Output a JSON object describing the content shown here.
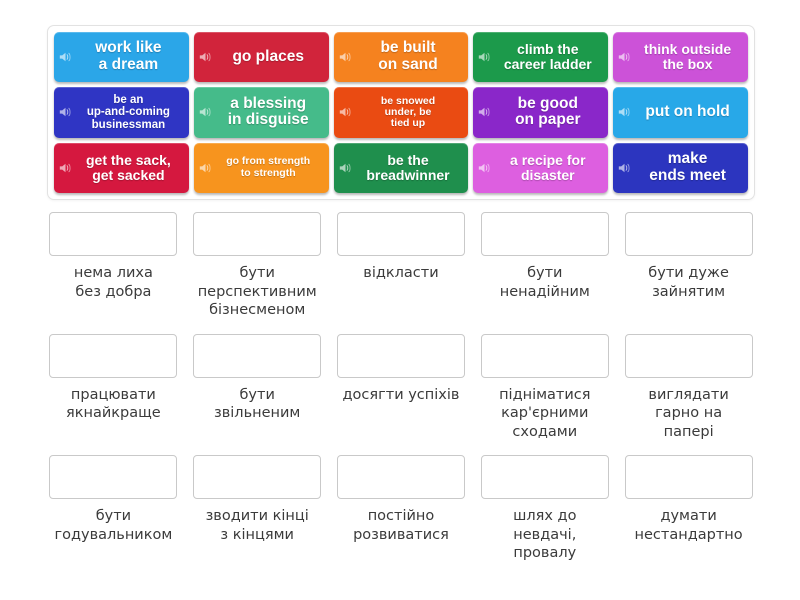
{
  "activity": {
    "type": "match-up-drag-drop",
    "icon": "speaker-icon",
    "colors": {
      "tile_row1": [
        "#2ba6e8",
        "#d1243b",
        "#f5821f",
        "#1c9a4b",
        "#cc52d8"
      ],
      "tile_row2": [
        "#2f35c4",
        "#45bb8a",
        "#ea4b12",
        "#8a27c9",
        "#28a8e8"
      ],
      "tile_row3": [
        "#d5183f",
        "#f7941e",
        "#1f8f4d",
        "#dd5fe0",
        "#2c35bf"
      ],
      "panel_border": "#e2e2e2",
      "dropzone_border": "#c9c9c9",
      "answer_text": "#3b3b3b"
    }
  },
  "tiles": [
    {
      "label": "work like\na dream",
      "color": "#2ba6e8",
      "size": "fs-lg"
    },
    {
      "label": "go places",
      "color": "#d1243b",
      "size": "fs-lg"
    },
    {
      "label": "be built\non sand",
      "color": "#f5821f",
      "size": "fs-lg"
    },
    {
      "label": "climb the\ncareer ladder",
      "color": "#1c9a4b",
      "size": "fs-md"
    },
    {
      "label": "think outside\nthe box",
      "color": "#cc52d8",
      "size": "fs-md"
    },
    {
      "label": "be an\nup-and-coming\nbusinessman",
      "color": "#2f35c4",
      "size": "fs-sm"
    },
    {
      "label": "a blessing\nin disguise",
      "color": "#45bb8a",
      "size": "fs-lg"
    },
    {
      "label": "be snowed\nunder, be\ntied up",
      "color": "#ea4b12",
      "size": "fs-xs"
    },
    {
      "label": "be good\non paper",
      "color": "#8a27c9",
      "size": "fs-lg"
    },
    {
      "label": "put on hold",
      "color": "#28a8e8",
      "size": "fs-lg"
    },
    {
      "label": "get the sack,\nget sacked",
      "color": "#d5183f",
      "size": "fs-md"
    },
    {
      "label": "go from strength\nto strength",
      "color": "#f7941e",
      "size": "fs-xs"
    },
    {
      "label": "be the\nbreadwinner",
      "color": "#1f8f4d",
      "size": "fs-md"
    },
    {
      "label": "a recipe for\ndisaster",
      "color": "#dd5fe0",
      "size": "fs-md"
    },
    {
      "label": "make\nends meet",
      "color": "#2c35bf",
      "size": "fs-lg"
    }
  ],
  "answers": [
    {
      "text": "нема лиха\nбез добра"
    },
    {
      "text": "бути\nперспективним\nбізнесменом"
    },
    {
      "text": "відкласти"
    },
    {
      "text": "бути\nненадійним"
    },
    {
      "text": "бути дуже\nзайнятим"
    },
    {
      "text": "працювати\nякнайкраще"
    },
    {
      "text": "бути\nзвільненим"
    },
    {
      "text": "досягти успіхів"
    },
    {
      "text": "підніматися\nкар'єрними\nсходами"
    },
    {
      "text": "виглядати\nгарно на\nпапері"
    },
    {
      "text": "бути\nгодувальником"
    },
    {
      "text": "зводити кінці\nз кінцями"
    },
    {
      "text": "постійно\nрозвиватися"
    },
    {
      "text": "шлях до\nневдачі,\nпровалу"
    },
    {
      "text": "думати\nнестандартно"
    }
  ]
}
